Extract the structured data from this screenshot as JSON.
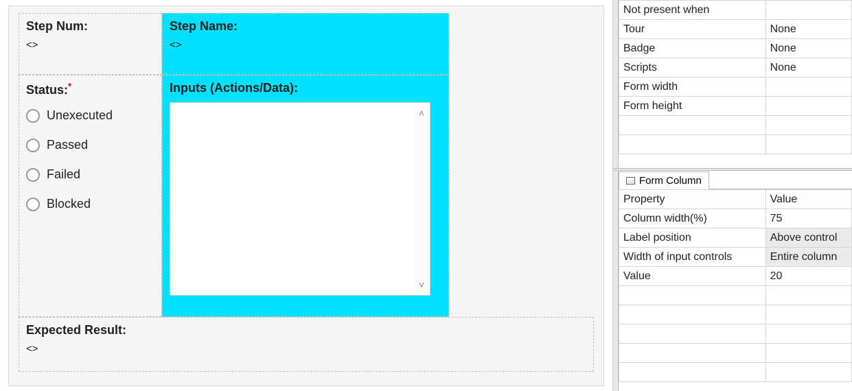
{
  "form": {
    "stepnum": {
      "label": "Step Num:",
      "value": "<>"
    },
    "stepname": {
      "label": "Step Name:",
      "value": "<>"
    },
    "status": {
      "label": "Status:",
      "options": [
        "Unexecuted",
        "Passed",
        "Failed",
        "Blocked"
      ]
    },
    "inputs": {
      "label": "Inputs (Actions/Data):",
      "value": ""
    },
    "expected": {
      "label": "Expected Result:",
      "value": "<>"
    }
  },
  "upper_props": [
    {
      "k": "Not present when",
      "v": ""
    },
    {
      "k": "Tour",
      "v": "None"
    },
    {
      "k": "Badge",
      "v": "None"
    },
    {
      "k": "Scripts",
      "v": "None"
    },
    {
      "k": "Form width",
      "v": ""
    },
    {
      "k": "Form height",
      "v": ""
    }
  ],
  "tab_label": "Form Column",
  "lower_header": {
    "k": "Property",
    "v": "Value"
  },
  "lower_props": [
    {
      "k": "Column width(%)",
      "v": "75",
      "sel": false
    },
    {
      "k": "Label position",
      "v": "Above control",
      "sel": true
    },
    {
      "k": "Width of input controls",
      "v": "Entire column",
      "sel": true
    },
    {
      "k": "Value",
      "v": "20",
      "sel": false
    }
  ]
}
